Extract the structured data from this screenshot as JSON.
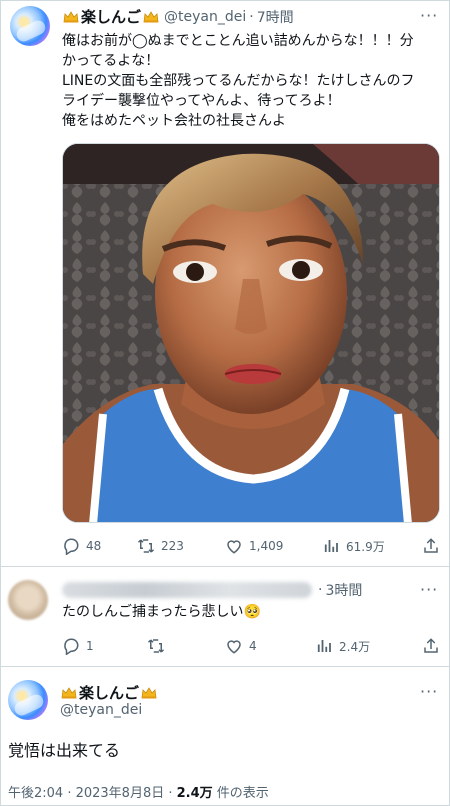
{
  "tweet1": {
    "name": "楽しんご",
    "handle": "@teyan_dei",
    "time": "7時間",
    "lines": [
      "俺はお前が◯ぬまでとことん追い詰めんからな！！！分",
      "かってるよな！",
      "LINEの文面も全部残ってるんだからな！たけしさんのフ",
      "ライデー襲撃位やってやんよ、待ってろよ！",
      "俺をはめたペット会社の社長さんよ"
    ],
    "stats": {
      "replies": "48",
      "retweets": "223",
      "likes": "1,409",
      "views": "61.9万"
    }
  },
  "reply": {
    "time": "3時間",
    "text": "たのしんご捕まったら悲しい🥺",
    "stats": {
      "replies": "1",
      "retweets": "",
      "likes": "4",
      "views": "2.4万"
    }
  },
  "tweet2": {
    "name": "楽しんご",
    "handle": "@teyan_dei",
    "text": "覚悟は出来てる",
    "footer_time": "午後2:04 · 2023年8月8日 · ",
    "footer_views": "2.4万",
    "footer_views_suffix": " 件の表示"
  },
  "icons": [
    "crown-icon",
    "more-icon",
    "reply-icon",
    "retweet-icon",
    "like-icon",
    "views-icon",
    "share-icon"
  ],
  "colors": {
    "icon_gray": "#536471",
    "border": "#cfd9de",
    "crown_gold": "#f2b51b"
  }
}
